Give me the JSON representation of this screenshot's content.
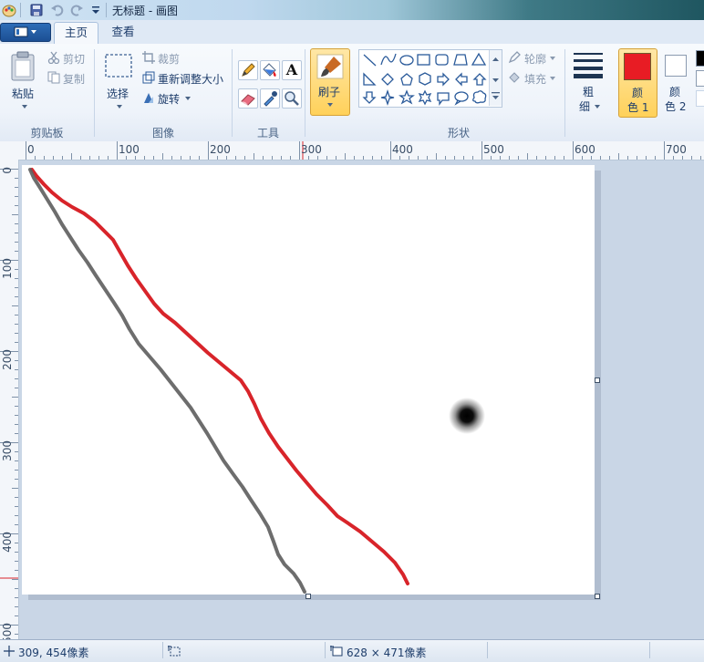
{
  "window": {
    "title": "无标题 - 画图"
  },
  "tabs": {
    "home": "主页",
    "view": "查看"
  },
  "clipboard": {
    "paste": "粘贴",
    "cut": "剪切",
    "copy": "复制",
    "label": "剪贴板"
  },
  "image": {
    "select": "选择",
    "crop": "裁剪",
    "resize": "重新调整大小",
    "rotate": "旋转",
    "label": "图像"
  },
  "tools": {
    "label": "工具",
    "text_tool": "A"
  },
  "brushes": {
    "label": "刷子"
  },
  "shapes": {
    "label": "形状",
    "outline": "轮廓",
    "fill": "填充"
  },
  "size": {
    "label_line1": "粗",
    "label_line2": "细"
  },
  "colors": {
    "color1_line1": "颜",
    "color1_line2": "色 1",
    "color2_line1": "颜",
    "color2_line2": "色 2",
    "color1_hex": "#e81c24",
    "color2_hex": "#ffffff"
  },
  "ruler_top": [
    "0",
    "100",
    "200",
    "300",
    "400",
    "500",
    "600",
    "700"
  ],
  "ruler_left": [
    "0",
    "100",
    "200",
    "300",
    "400",
    "500"
  ],
  "status": {
    "cursor_position": "309, 454像素",
    "image_size": "628 × 471像素"
  },
  "drawing": {
    "stroke1_color": "#d8242a",
    "stroke2_color": "#616161",
    "dot_color": "#000000"
  }
}
